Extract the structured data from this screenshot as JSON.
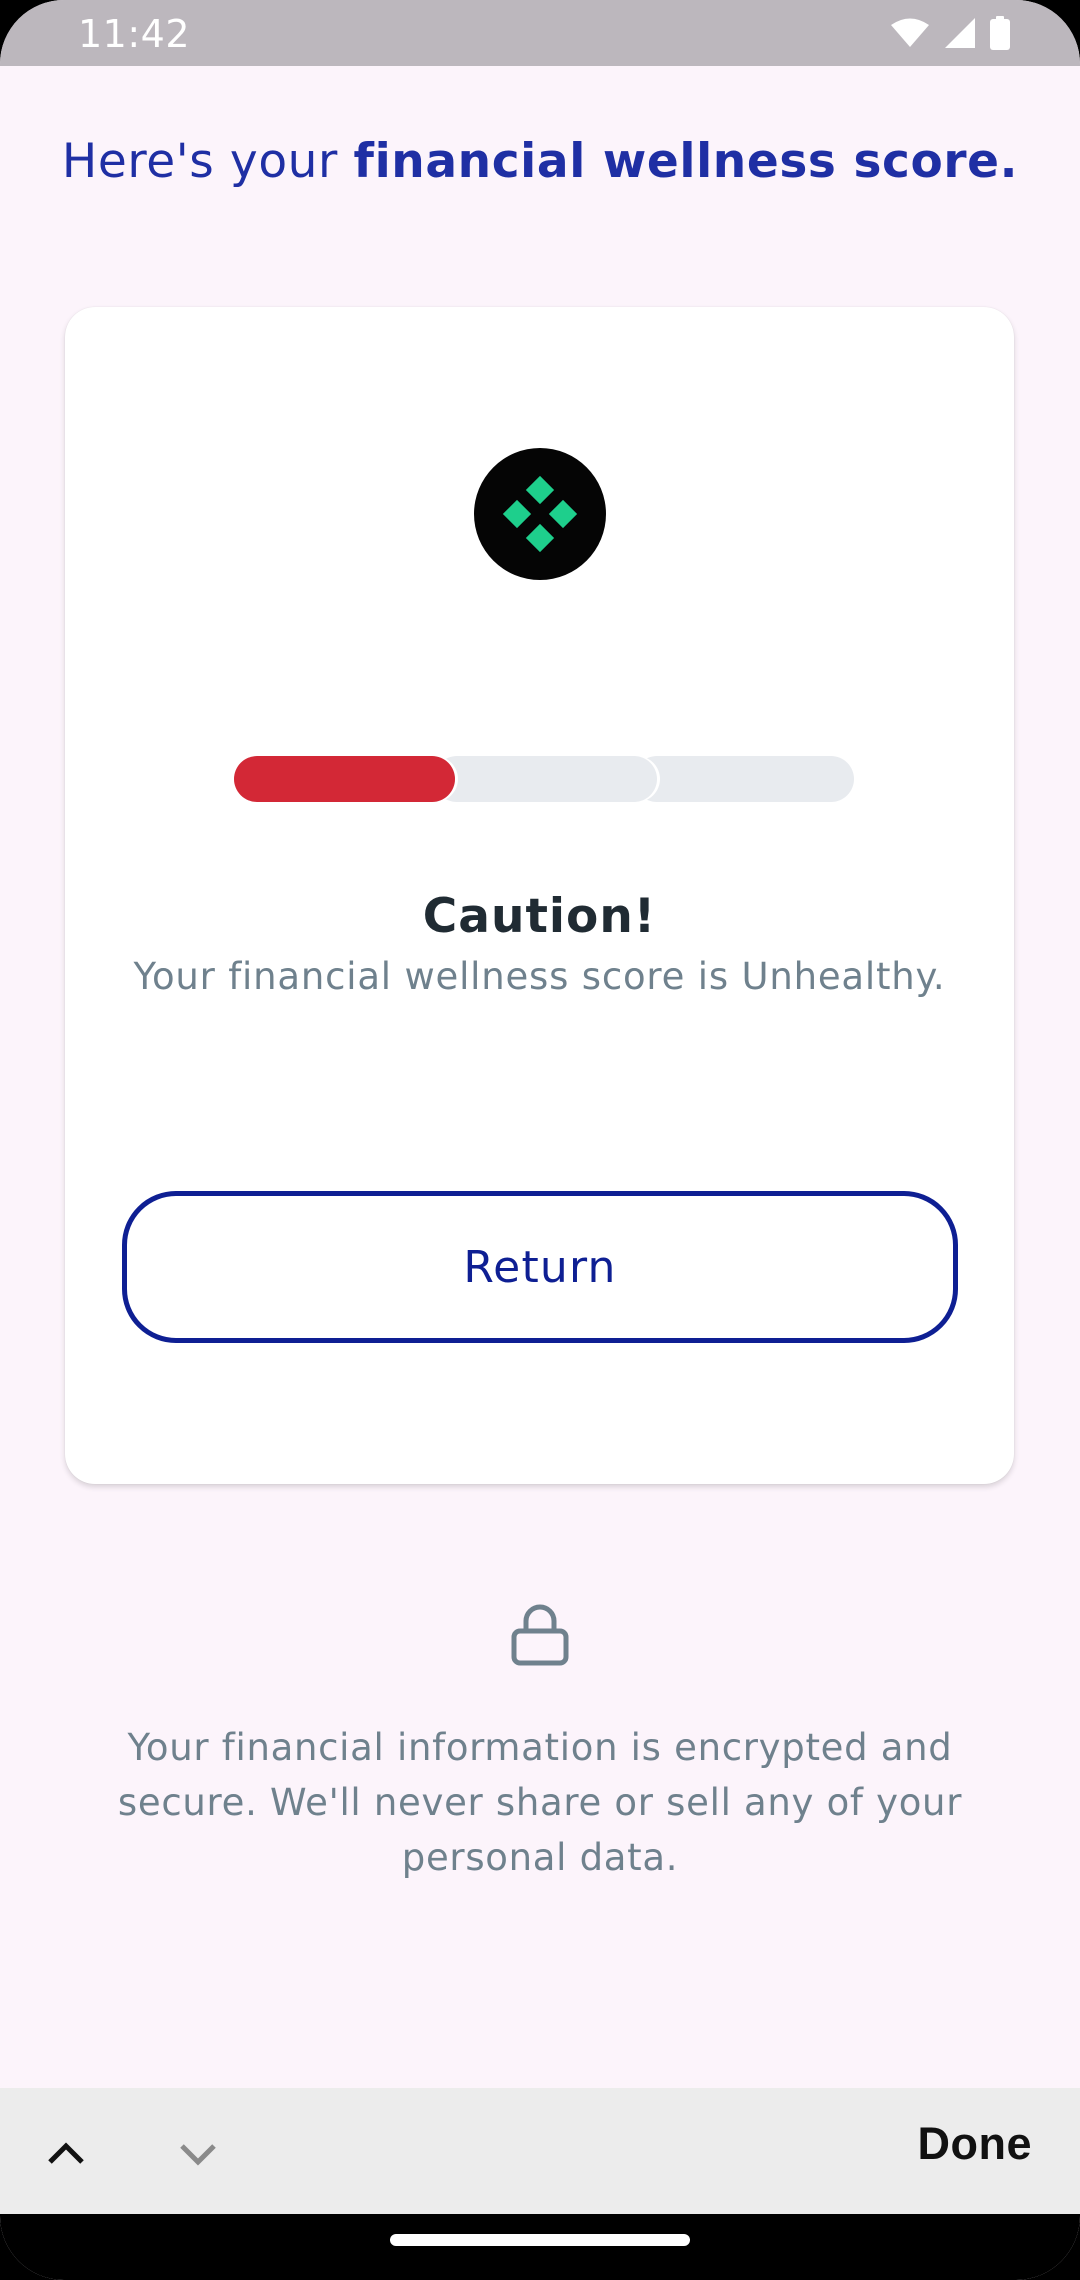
{
  "status_bar": {
    "time": "11:42",
    "icons": [
      "wifi-icon",
      "signal-icon",
      "battery-icon"
    ]
  },
  "headline": {
    "prefix": "Here's your ",
    "emphasis": "financial wellness score."
  },
  "card": {
    "logo_icon": "diamond-grid-logo",
    "score_bar": {
      "segments": 3,
      "filled_segments": 1,
      "filled_color": "#d32836",
      "empty_color": "#e8ebef"
    },
    "title": "Caution!",
    "subtitle": "Your financial wellness score is Unhealthy.",
    "return_label": "Return"
  },
  "security": {
    "icon": "lock-icon",
    "text": "Your financial information is encrypted and secure. We'll never share or sell any of your personal data."
  },
  "accessory_bar": {
    "up_icon": "chevron-up-icon",
    "down_icon": "chevron-down-icon",
    "done_label": "Done"
  },
  "colors": {
    "accent": "#1f2fa4",
    "button_border": "#0e1f93",
    "background": "#fcf4fb",
    "logo_green": "#1ecf8c"
  }
}
